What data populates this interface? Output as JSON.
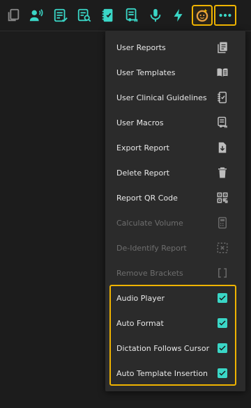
{
  "accent_color": "#3ad6c6",
  "highlight_color": "#f0b400",
  "toolbar": {
    "buttons": [
      {
        "name": "copy-icon"
      },
      {
        "name": "voice-user-icon"
      },
      {
        "name": "checklist-icon"
      },
      {
        "name": "search-report-icon"
      },
      {
        "name": "guidelines-icon"
      },
      {
        "name": "macros-icon"
      },
      {
        "name": "microphone-icon"
      },
      {
        "name": "lightning-icon"
      },
      {
        "name": "profile-icon"
      },
      {
        "name": "more-icon"
      }
    ]
  },
  "menu": {
    "items": [
      {
        "label": "User Reports",
        "icon": "reports-icon",
        "enabled": true
      },
      {
        "label": "User Templates",
        "icon": "book-icon",
        "enabled": true
      },
      {
        "label": "User Clinical Guidelines",
        "icon": "guidelines-icon",
        "enabled": true
      },
      {
        "label": "User Macros",
        "icon": "macros-icon",
        "enabled": true
      },
      {
        "label": "Export Report",
        "icon": "download-file-icon",
        "enabled": true
      },
      {
        "label": "Delete Report",
        "icon": "trash-icon",
        "enabled": true
      },
      {
        "label": "Report QR Code",
        "icon": "qr-code-icon",
        "enabled": true
      },
      {
        "label": "Calculate Volume",
        "icon": "calculator-icon",
        "enabled": false
      },
      {
        "label": "De-Identify Report",
        "icon": "de-identify-icon",
        "enabled": false
      },
      {
        "label": "Remove Brackets",
        "icon": "brackets-icon",
        "enabled": false
      }
    ],
    "toggles": [
      {
        "label": "Audio Player",
        "checked": true
      },
      {
        "label": "Auto Format",
        "checked": true
      },
      {
        "label": "Dictation Follows Cursor",
        "checked": true
      },
      {
        "label": "Auto Template Insertion",
        "checked": true
      }
    ]
  }
}
